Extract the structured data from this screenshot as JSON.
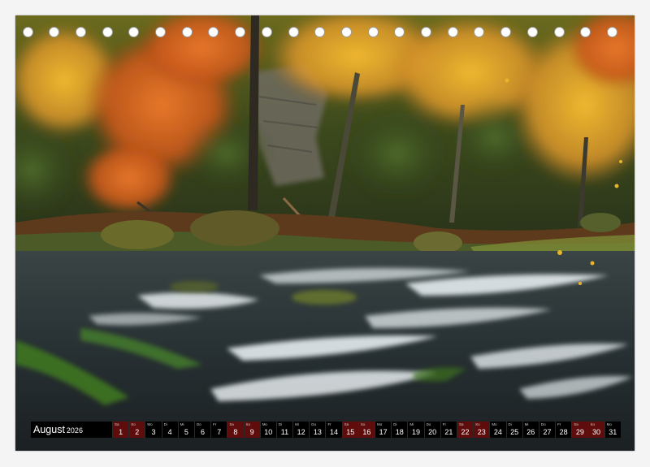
{
  "calendar": {
    "month_label": "August",
    "year_label": "2026",
    "days": [
      {
        "num": "1",
        "weekday": "Sa",
        "weekend": true
      },
      {
        "num": "2",
        "weekday": "So",
        "weekend": true
      },
      {
        "num": "3",
        "weekday": "Mo",
        "weekend": false
      },
      {
        "num": "4",
        "weekday": "Di",
        "weekend": false
      },
      {
        "num": "5",
        "weekday": "Mi",
        "weekend": false
      },
      {
        "num": "6",
        "weekday": "Do",
        "weekend": false
      },
      {
        "num": "7",
        "weekday": "Fr",
        "weekend": false
      },
      {
        "num": "8",
        "weekday": "Sa",
        "weekend": true
      },
      {
        "num": "9",
        "weekday": "So",
        "weekend": true
      },
      {
        "num": "10",
        "weekday": "Mo",
        "weekend": false
      },
      {
        "num": "11",
        "weekday": "Di",
        "weekend": false
      },
      {
        "num": "12",
        "weekday": "Mi",
        "weekend": false
      },
      {
        "num": "13",
        "weekday": "Do",
        "weekend": false
      },
      {
        "num": "14",
        "weekday": "Fr",
        "weekend": false
      },
      {
        "num": "15",
        "weekday": "Sa",
        "weekend": true
      },
      {
        "num": "16",
        "weekday": "So",
        "weekend": true
      },
      {
        "num": "17",
        "weekday": "Mo",
        "weekend": false
      },
      {
        "num": "18",
        "weekday": "Di",
        "weekend": false
      },
      {
        "num": "19",
        "weekday": "Mi",
        "weekend": false
      },
      {
        "num": "20",
        "weekday": "Do",
        "weekend": false
      },
      {
        "num": "21",
        "weekday": "Fr",
        "weekend": false
      },
      {
        "num": "22",
        "weekday": "Sa",
        "weekend": true
      },
      {
        "num": "23",
        "weekday": "So",
        "weekend": true
      },
      {
        "num": "24",
        "weekday": "Mo",
        "weekend": false
      },
      {
        "num": "25",
        "weekday": "Di",
        "weekend": false
      },
      {
        "num": "26",
        "weekday": "Mi",
        "weekend": false
      },
      {
        "num": "27",
        "weekday": "Do",
        "weekend": false
      },
      {
        "num": "28",
        "weekday": "Fr",
        "weekend": false
      },
      {
        "num": "29",
        "weekday": "Sa",
        "weekend": true
      },
      {
        "num": "30",
        "weekday": "So",
        "weekend": true
      },
      {
        "num": "31",
        "weekday": "Mo",
        "weekend": false
      }
    ]
  },
  "binding": {
    "hole_count": 23
  },
  "colors": {
    "strip_background": "#000000",
    "weekend_cell": "#5e0c0c",
    "autumn_orange": "#e07a1f",
    "autumn_yellow": "#e8b52a",
    "forest_green": "#3f5a23",
    "water_white": "#e6ecef"
  }
}
